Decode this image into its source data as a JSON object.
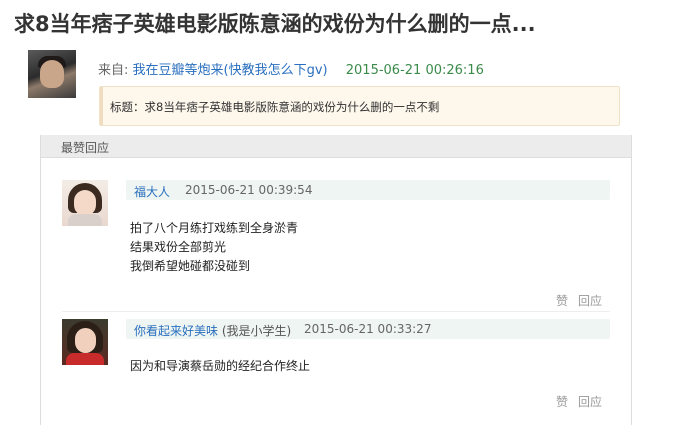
{
  "post": {
    "title": "求8当年痞子英雄电影版陈意涵的戏份为什么删的一点...",
    "from_label": "来自:",
    "author": "我在豆瓣等炮来(快教我怎么下gv)",
    "date": "2015-06-21 00:26:16",
    "subject": "标题：求8当年痞子英雄电影版陈意涵的戏份为什么删的一点不剩"
  },
  "replies_section": {
    "header": "最赞回应"
  },
  "replies": [
    {
      "user": "福大人",
      "user_note": "",
      "date": "2015-06-21 00:39:54",
      "lines": [
        "拍了八个月练打戏练到全身淤青",
        "结果戏份全部剪光",
        "我倒希望她碰都没碰到"
      ],
      "like_label": "赞",
      "reply_label": "回应"
    },
    {
      "user": "你看起来好美味",
      "user_note": "(我是小学生)",
      "date": "2015-06-21 00:33:27",
      "lines": [
        "因为和导演蔡岳勋的经纪合作终止"
      ],
      "like_label": "赞",
      "reply_label": "回应"
    }
  ],
  "colors": {
    "link_blue": "#2a6fbf",
    "date_green": "#3a8a4a",
    "subject_bg": "#fdf7ec",
    "reply_head_bg": "#eef5f2"
  }
}
